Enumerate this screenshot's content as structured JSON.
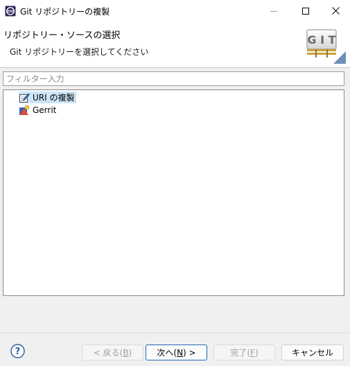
{
  "window": {
    "title": "Git リポジトリーの複製",
    "icons": {
      "app": "eclipse-app-icon",
      "minimize": "minimize-icon",
      "maximize": "maximize-icon",
      "close": "close-icon"
    }
  },
  "header": {
    "title": "リポジトリー・ソースの選択",
    "description": "Git リポジトリーを選択してください",
    "logo_text": "GIT"
  },
  "filter": {
    "placeholder": "フィルター入力",
    "value": ""
  },
  "tree": {
    "items": [
      {
        "label": "URI の複製",
        "icon": "clone-uri-icon",
        "selected": true
      },
      {
        "label": "Gerrit",
        "icon": "gerrit-icon",
        "selected": false
      }
    ]
  },
  "buttons": {
    "back": {
      "text": "< 戻る(",
      "mnemonic": "B",
      "suffix": ")",
      "enabled": false
    },
    "next": {
      "text": "次へ(",
      "mnemonic": "N",
      "suffix": ") >",
      "enabled": true
    },
    "finish": {
      "text": "完了(",
      "mnemonic": "F",
      "suffix": ")",
      "enabled": false
    },
    "cancel": {
      "text": "キャンセル",
      "enabled": true
    }
  },
  "help_icon": "help-icon",
  "colors": {
    "selection": "#cce4f7",
    "default_button_border": "#1f66b5",
    "disabled_text": "#a0a0a0"
  }
}
